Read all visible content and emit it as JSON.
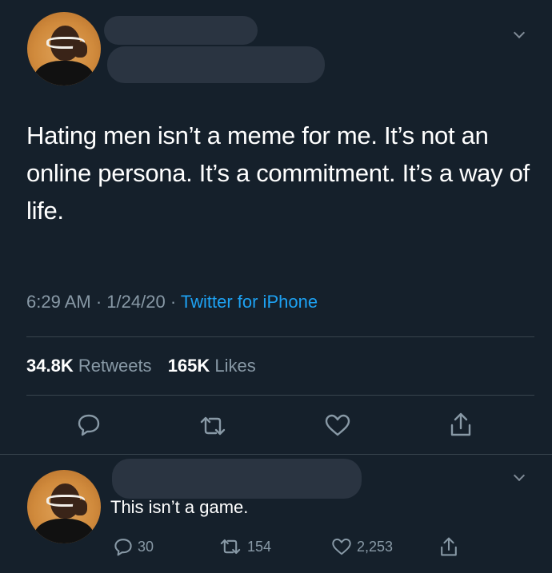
{
  "tweet": {
    "text": "Hating men isn’t a meme for me. It’s not an online persona. It’s a commitment. It’s a way of life.",
    "time": "6:29 AM",
    "date": "1/24/20",
    "separator": "·",
    "source": "Twitter for iPhone",
    "retweets_count": "34.8K",
    "retweets_label": "Retweets",
    "likes_count": "165K",
    "likes_label": "Likes"
  },
  "reply": {
    "text": "This isn’t a game.",
    "replies": "30",
    "retweets": "154",
    "likes": "2,253"
  },
  "colors": {
    "background": "#15202b",
    "muted": "#8899a6",
    "accent": "#1da1f2",
    "divider": "#38444d"
  }
}
